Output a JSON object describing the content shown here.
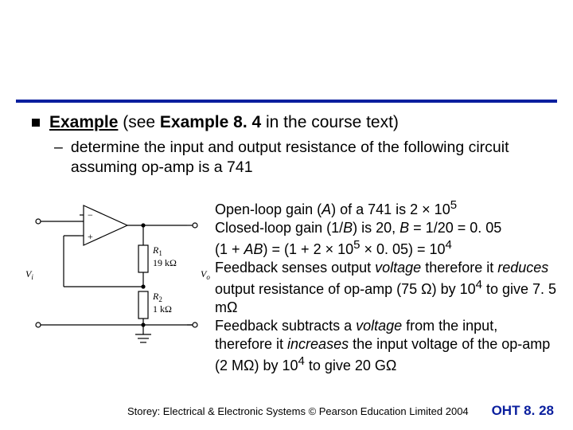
{
  "heading": {
    "label_example": "Example",
    "see_1": " (see ",
    "bold_ref": "Example 8. 4",
    "see_2": " in the course text)"
  },
  "sub": {
    "line": "determine the input and output resistance of the following circuit assuming op-amp is a 741"
  },
  "paras": {
    "p1a": "Open-loop gain (",
    "p1_A": "A",
    "p1b": ") of a 741 is 2 × 10",
    "p1_exp": "5",
    "p2a": "Closed-loop gain (1/",
    "p2_B1": "B",
    "p2b": ") is 20, ",
    "p2_B2": "B",
    "p2c": " = 1/20 = 0. 05",
    "p3a": "(1 + ",
    "p3_AB": "AB",
    "p3b": ") = (1 + 2 × 10",
    "p3_e5a": "5",
    "p3c": " × 0. 05) = 10",
    "p3_e4": "4",
    "p4a": "Feedback senses output ",
    "p4_volt": "voltage",
    "p4b": " therefore it ",
    "p4_red": "reduces",
    "p4c": " output resistance of op-amp (75 Ω) by 10",
    "p4_e4": "4",
    "p4d": " to give 7. 5 mΩ",
    "p5a": "Feedback subtracts a ",
    "p5_volt": "voltage",
    "p5b": " from the input, therefore it ",
    "p5_inc": "increases",
    "p5c": " the input voltage of the op-amp (2 MΩ) by 10",
    "p5_e4": "4",
    "p5d": " to give 20 GΩ"
  },
  "fig": {
    "Vi": "V",
    "Vi_sub": "i",
    "Vo": "V",
    "Vo_sub": "o",
    "minus": "−",
    "plus": "+",
    "R1": "R",
    "R1_sub": "1",
    "R1_val": "19 kΩ",
    "R2": "R",
    "R2_sub": "2",
    "R2_val": "1 kΩ"
  },
  "footer": {
    "left": "Storey: Electrical & Electronic Systems © Pearson Education Limited 2004",
    "right": "OHT 8. 28"
  }
}
